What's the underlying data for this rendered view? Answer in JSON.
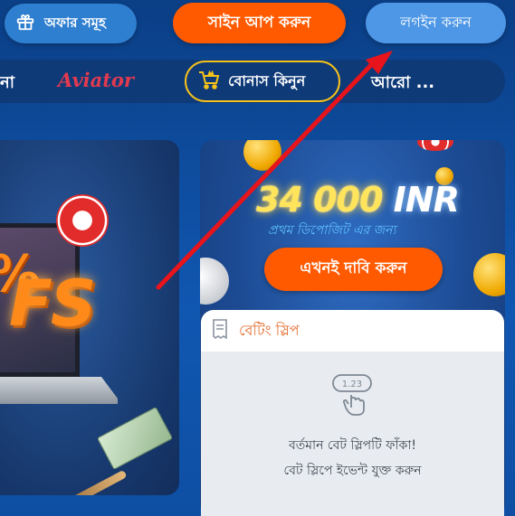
{
  "header": {
    "offers_label": "অফার সমূহ",
    "signup_label": "সাইন আপ করুন",
    "login_label": "লগইন করুন"
  },
  "nav": {
    "cut_item": "না",
    "aviator_label": "Aviator",
    "bonus_label": "বোনাস কিনুন",
    "more_label": "আরো ..."
  },
  "promo_left": {
    "percent_text": "%",
    "fs_text": "FS"
  },
  "promo_right": {
    "amount": "34 000",
    "currency": "INR",
    "subtitle": "প্রথম ডিপোজিট এর জন্য",
    "claim_label": "এখনই দাবি করুন"
  },
  "bet_slip": {
    "title": "বেটিং স্লিপ",
    "empty_icon_text": "1.23",
    "empty_line1": "বর্তমান বেট স্লিপটি ফাঁকা!",
    "empty_line2": "বেট স্লিপে ইভেন্ট যুক্ত করুন"
  },
  "colors": {
    "accent_orange": "#ff5a00",
    "login_blue": "#4e97e6",
    "bonus_gold": "#f6c21a",
    "slip_title": "#e46a2a",
    "annotation_red": "#e8141b"
  }
}
